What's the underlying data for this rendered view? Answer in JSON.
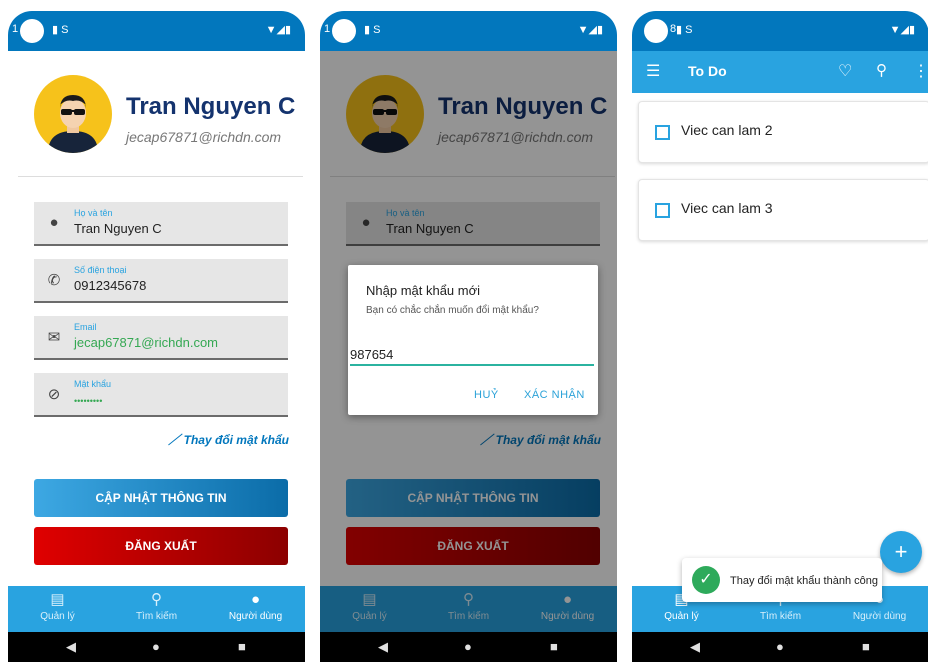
{
  "status": {
    "left_icons": "▮ S",
    "right_icons": "▼◢▮",
    "left_digit_1": "1",
    "left_digit_3": "8"
  },
  "profile": {
    "name": "Tran Nguyen C",
    "email": "jecap67871@richdn.com",
    "fields": [
      {
        "label": "Họ và tên",
        "value": "Tran Nguyen C"
      },
      {
        "label": "Số điện thoại",
        "value": "0912345678"
      },
      {
        "label": "Email",
        "value": "jecap67871@richdn.com"
      },
      {
        "label": "Mật khẩu",
        "value": "•••••••••"
      }
    ],
    "change_password_link": "Thay đổi mật khẩu",
    "update_button": "CẬP NHẬT THÔNG TIN",
    "logout_button": "ĐĂNG XUẤT"
  },
  "bottom_nav": [
    {
      "label": "Quản lý",
      "icon": "calendar-icon"
    },
    {
      "label": "Tìm kiếm",
      "icon": "search-icon"
    },
    {
      "label": "Người dùng",
      "icon": "person-icon"
    }
  ],
  "dialog": {
    "title": "Nhập mật khẩu mới",
    "message": "Bạn có chắc chắn muốn đổi mật khẩu?",
    "input_value": "987654",
    "cancel": "HUỶ",
    "confirm": "XÁC NHẬN"
  },
  "todo": {
    "title": "To Do",
    "items": [
      "Viec can lam 2",
      "Viec can lam 3"
    ],
    "fab": "+",
    "toast": "Thay đổi mật khẩu thành công"
  },
  "colors": {
    "primary": "#29a3e0",
    "status_bar": "#0277bd",
    "name": "#14336e",
    "logout": "#d00000",
    "success": "#2eaa5b"
  }
}
